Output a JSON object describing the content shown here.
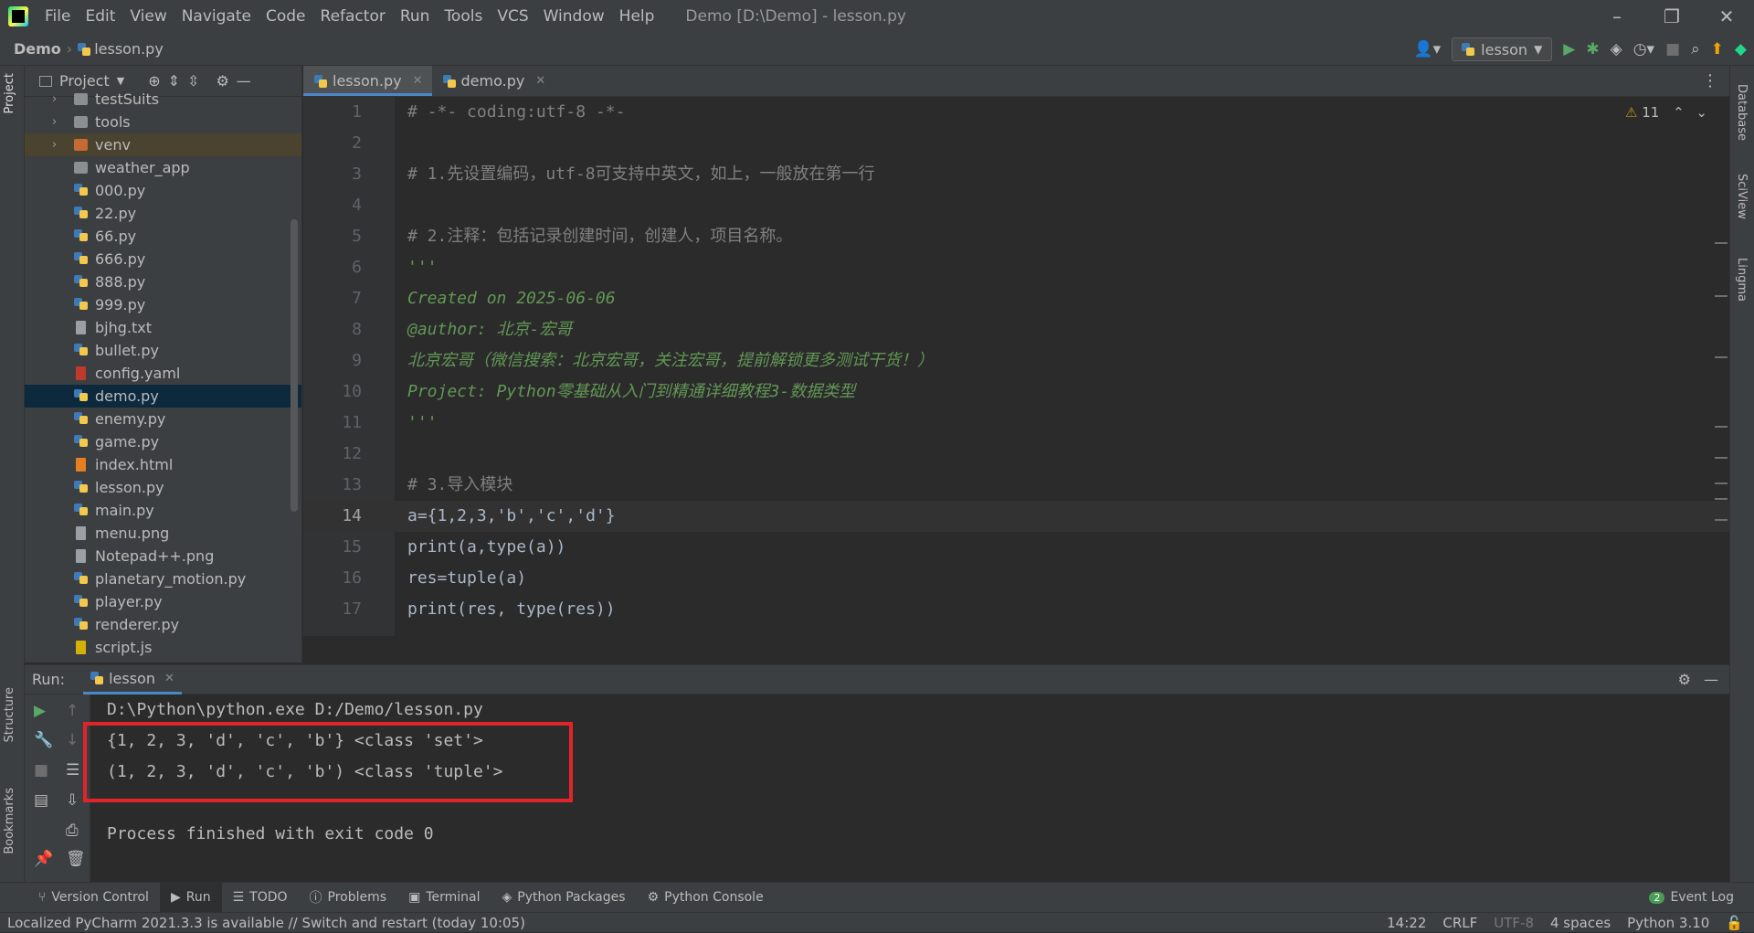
{
  "titlebar": {
    "menu": [
      "File",
      "Edit",
      "View",
      "Navigate",
      "Code",
      "Refactor",
      "Run",
      "Tools",
      "VCS",
      "Window",
      "Help"
    ],
    "window_title": "Demo [D:\\Demo] - lesson.py"
  },
  "navbar": {
    "project": "Demo",
    "file": "lesson.py",
    "run_config": "lesson"
  },
  "project_panel": {
    "title": "Project",
    "items": [
      {
        "label": "testSuits",
        "type": "folder",
        "expandable": true
      },
      {
        "label": "tools",
        "type": "folder",
        "expandable": true
      },
      {
        "label": "venv",
        "type": "folder-orange",
        "expandable": true
      },
      {
        "label": "weather_app",
        "type": "folder",
        "expandable": false
      },
      {
        "label": "000.py",
        "type": "py"
      },
      {
        "label": "22.py",
        "type": "py"
      },
      {
        "label": "66.py",
        "type": "py"
      },
      {
        "label": "666.py",
        "type": "py"
      },
      {
        "label": "888.py",
        "type": "py"
      },
      {
        "label": "999.py",
        "type": "py"
      },
      {
        "label": "bjhg.txt",
        "type": "txt"
      },
      {
        "label": "bullet.py",
        "type": "py"
      },
      {
        "label": "config.yaml",
        "type": "yaml"
      },
      {
        "label": "demo.py",
        "type": "py",
        "selected": true
      },
      {
        "label": "enemy.py",
        "type": "py"
      },
      {
        "label": "game.py",
        "type": "py"
      },
      {
        "label": "index.html",
        "type": "html"
      },
      {
        "label": "lesson.py",
        "type": "py"
      },
      {
        "label": "main.py",
        "type": "py"
      },
      {
        "label": "menu.png",
        "type": "png"
      },
      {
        "label": "Notepad++.png",
        "type": "png"
      },
      {
        "label": "planetary_motion.py",
        "type": "py"
      },
      {
        "label": "player.py",
        "type": "py"
      },
      {
        "label": "renderer.py",
        "type": "py"
      },
      {
        "label": "script.js",
        "type": "js"
      }
    ]
  },
  "editor": {
    "tabs": [
      {
        "label": "lesson.py",
        "active": true
      },
      {
        "label": "demo.py",
        "active": false
      }
    ],
    "warning_count": "11",
    "lines": [
      {
        "n": "1",
        "text": "# -*- coding:utf-8 -*-",
        "cls": "cm"
      },
      {
        "n": "2",
        "text": "",
        "cls": "kw"
      },
      {
        "n": "3",
        "text": "# 1.先设置编码，utf-8可支持中英文，如上，一般放在第一行",
        "cls": "cm"
      },
      {
        "n": "4",
        "text": "",
        "cls": "kw"
      },
      {
        "n": "5",
        "text": "# 2.注释：包括记录创建时间，创建人，项目名称。",
        "cls": "cm"
      },
      {
        "n": "6",
        "text": "'''",
        "cls": "doc"
      },
      {
        "n": "7",
        "text": "Created on 2025-06-06",
        "cls": "doc"
      },
      {
        "n": "8",
        "text": "@author: 北京-宏哥",
        "cls": "doc"
      },
      {
        "n": "9",
        "text": "北京宏哥（微信搜索：北京宏哥，关注宏哥，提前解锁更多测试干货！）",
        "cls": "doc"
      },
      {
        "n": "10",
        "text": "Project: Python零基础从入门到精通详细教程3-数据类型",
        "cls": "doc"
      },
      {
        "n": "11",
        "text": "'''",
        "cls": "doc"
      },
      {
        "n": "12",
        "text": "",
        "cls": "kw"
      },
      {
        "n": "13",
        "text": "# 3.导入模块",
        "cls": "cm"
      },
      {
        "n": "14",
        "text": "a={1,2,3,'b','c','d'}",
        "cls": "kw"
      },
      {
        "n": "15",
        "text": "print(a,type(a))",
        "cls": "kw"
      },
      {
        "n": "16",
        "text": "res=tuple(a)",
        "cls": "kw"
      },
      {
        "n": "17",
        "text": "print(res, type(res))",
        "cls": "kw"
      }
    ]
  },
  "run_panel": {
    "label": "Run:",
    "tab": "lesson",
    "output": [
      "D:\\Python\\python.exe D:/Demo/lesson.py",
      "{1, 2, 3, 'd', 'c', 'b'} <class 'set'>",
      "(1, 2, 3, 'd', 'c', 'b') <class 'tuple'>",
      "",
      "Process finished with exit code 0"
    ]
  },
  "left_strip": {
    "project": "Project",
    "structure": "Structure",
    "bookmarks": "Bookmarks"
  },
  "right_strip": {
    "database": "Database",
    "sciview": "SciView",
    "lingma": "Lingma"
  },
  "bottom_tabs": [
    "Version Control",
    "Run",
    "TODO",
    "Problems",
    "Terminal",
    "Python Packages",
    "Python Console"
  ],
  "event_log": {
    "count": "2",
    "label": "Event Log"
  },
  "statusbar": {
    "message": "Localized PyCharm 2021.3.3 is available // Switch and restart (today 10:05)",
    "position": "14:22",
    "line_sep": "CRLF",
    "encoding": "UTF-8",
    "indent": "4 spaces",
    "interpreter": "Python 3.10"
  },
  "colors": {
    "accent": "#4a88c7",
    "highlight_box": "#e0242a"
  }
}
